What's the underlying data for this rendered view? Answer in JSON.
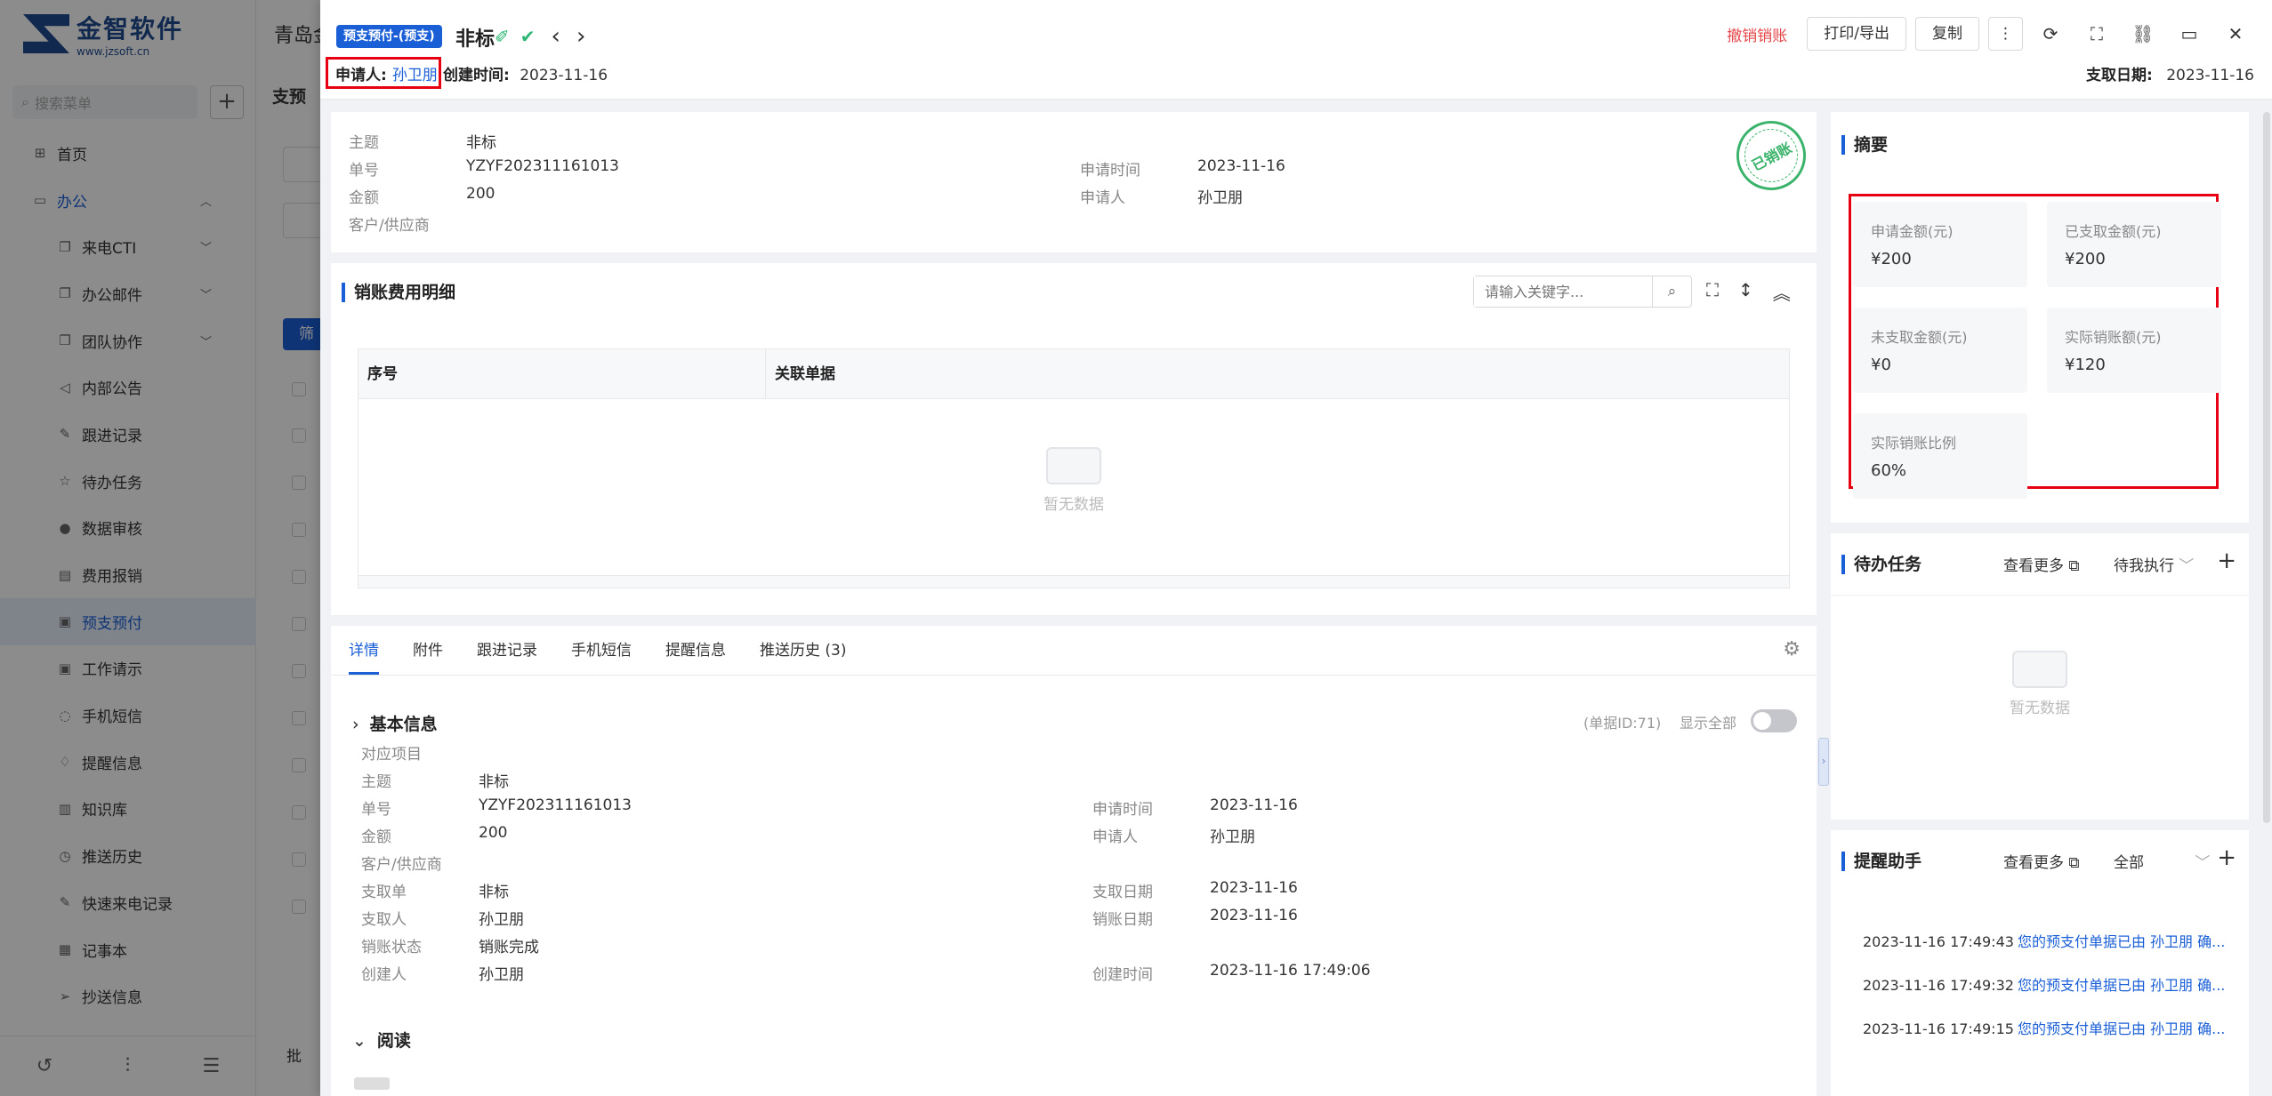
{
  "sidebar": {
    "logo_name": "金智软件",
    "logo_url": "www.jzsoft.cn",
    "search_placeholder": "搜索菜单",
    "add_label": "+",
    "items": [
      {
        "label": "首页",
        "icon": "home-icon"
      },
      {
        "label": "办公",
        "icon": "office-icon"
      },
      {
        "label": "来电CTI",
        "icon": "copy-icon"
      },
      {
        "label": "办公邮件",
        "icon": "copy-icon"
      },
      {
        "label": "团队协作",
        "icon": "copy-icon"
      },
      {
        "label": "内部公告",
        "icon": "speaker-icon"
      },
      {
        "label": "跟进记录",
        "icon": "edit-icon"
      },
      {
        "label": "待办任务",
        "icon": "pin-icon"
      },
      {
        "label": "数据审核",
        "icon": "user-icon"
      },
      {
        "label": "费用报销",
        "icon": "receipt-icon"
      },
      {
        "label": "预支预付",
        "icon": "document-icon"
      },
      {
        "label": "工作请示",
        "icon": "document-icon"
      },
      {
        "label": "手机短信",
        "icon": "chat-icon"
      },
      {
        "label": "提醒信息",
        "icon": "bell-icon"
      },
      {
        "label": "知识库",
        "icon": "book-icon"
      },
      {
        "label": "推送历史",
        "icon": "clock-icon"
      },
      {
        "label": "快速来电记录",
        "icon": "edit-icon"
      },
      {
        "label": "记事本",
        "icon": "notebook-icon"
      },
      {
        "label": "抄送信息",
        "icon": "send-icon"
      }
    ]
  },
  "background_page": {
    "title": "青岛金",
    "section": "支预",
    "button": "筛",
    "bottom": "批"
  },
  "drawer": {
    "tag": "预支预付-(预支)",
    "title": "非标",
    "applicant_label": "申请人:",
    "applicant_name": "孙卫朋",
    "created_label": "创建时间:",
    "created_value": "2023-11-16",
    "undo_label": "撤销销账",
    "print_label": "打印/导出",
    "copy_label": "复制",
    "pay_date_label": "支取日期:",
    "pay_date_value": "2023-11-16"
  },
  "info": {
    "subject_k": "主题",
    "subject_v": "非标",
    "no_k": "单号",
    "no_v": "YZYF202311161013",
    "amount_k": "金额",
    "amount_v": "200",
    "customer_k": "客户/供应商",
    "applytime_k": "申请时间",
    "applytime_v": "2023-11-16",
    "applicant_k": "申请人",
    "applicant_v": "孙卫朋",
    "stamp": "已销账"
  },
  "detail": {
    "title": "销账费用明细",
    "search_placeholder": "请输入关键字...",
    "col1": "序号",
    "col2": "关联单据",
    "empty": "暂无数据"
  },
  "tabs": {
    "items": [
      "详情",
      "附件",
      "跟进记录",
      "手机短信",
      "提醒信息",
      "推送历史 (3)"
    ],
    "basic_title": "基本信息",
    "doc_id": "(单据ID:71)",
    "show_all": "显示全部",
    "read_title": "阅读",
    "fields": {
      "project_k": "对应项目",
      "subject_k": "主题",
      "subject_v": "非标",
      "no_k": "单号",
      "no_v": "YZYF202311161013",
      "amount_k": "金额",
      "amount_v": "200",
      "customer_k": "客户/供应商",
      "paybill_k": "支取单",
      "paybill_v": "非标",
      "payee_k": "支取人",
      "payee_v": "孙卫朋",
      "status_k": "销账状态",
      "status_v": "销账完成",
      "creator_k": "创建人",
      "creator_v": "孙卫朋",
      "applytime_k": "申请时间",
      "applytime_v": "2023-11-16",
      "applicant_k": "申请人",
      "applicant_v": "孙卫朋",
      "paydate_k": "支取日期",
      "paydate_v": "2023-11-16",
      "writeoff_k": "销账日期",
      "writeoff_v": "2023-11-16",
      "ctime_k": "创建时间",
      "ctime_v": "2023-11-16 17:49:06"
    }
  },
  "summary": {
    "title": "摘要",
    "stats": [
      {
        "label": "申请金额(元)",
        "value": "¥200"
      },
      {
        "label": "已支取金额(元)",
        "value": "¥200"
      },
      {
        "label": "未支取金额(元)",
        "value": "¥0"
      },
      {
        "label": "实际销账额(元)",
        "value": "¥120"
      },
      {
        "label": "实际销账比例",
        "value": "60%"
      }
    ]
  },
  "todo": {
    "title": "待办任务",
    "more": "查看更多",
    "filter": "待我执行",
    "empty": "暂无数据"
  },
  "remind": {
    "title": "提醒助手",
    "more": "查看更多",
    "filter": "全部",
    "items": [
      {
        "time": "2023-11-16 17:49:43",
        "msg": "您的预支付单据已由 孙卫朋 确..."
      },
      {
        "time": "2023-11-16 17:49:32",
        "msg": "您的预支付单据已由 孙卫朋 确..."
      },
      {
        "time": "2023-11-16 17:49:15",
        "msg": "您的预支付单据已由 孙卫朋 确..."
      }
    ]
  },
  "colors": {
    "accent": "#1a5fd6",
    "highlight": "#e60012",
    "success": "#3ab36a",
    "danger": "#e5474b"
  }
}
